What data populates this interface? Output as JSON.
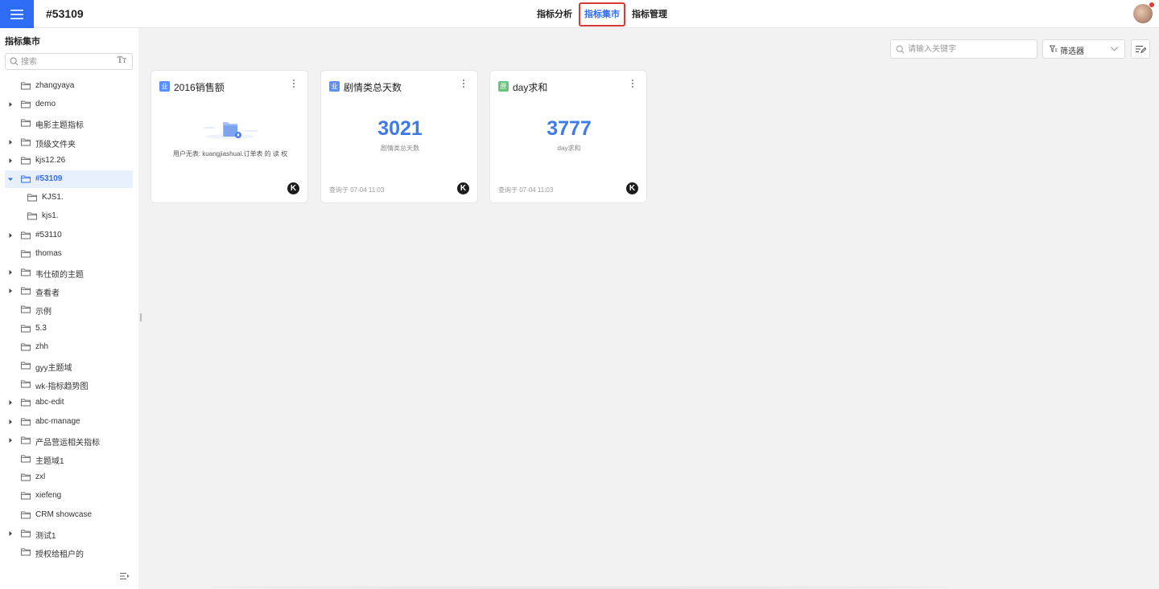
{
  "header": {
    "title": "#53109",
    "tabs": [
      {
        "label": "指标分析",
        "active": false
      },
      {
        "label": "指标集市",
        "active": true
      },
      {
        "label": "指标管理",
        "active": false
      }
    ],
    "accent_color": "#2f6cf6",
    "highlight_color": "#d73a35"
  },
  "sidebar": {
    "title": "指标集市",
    "search_placeholder": "搜索",
    "items": [
      {
        "label": "zhangyaya",
        "expandable": false,
        "expanded": false,
        "level": 0
      },
      {
        "label": "demo",
        "expandable": true,
        "expanded": false,
        "level": 0
      },
      {
        "label": "电影主题指标",
        "expandable": false,
        "expanded": false,
        "level": 0
      },
      {
        "label": "顶级文件夹",
        "expandable": true,
        "expanded": false,
        "level": 0
      },
      {
        "label": "kjs12.26",
        "expandable": true,
        "expanded": false,
        "level": 0
      },
      {
        "label": "#53109",
        "expandable": true,
        "expanded": true,
        "level": 0,
        "selected": true
      },
      {
        "label": "KJS1.",
        "expandable": false,
        "expanded": false,
        "level": 1
      },
      {
        "label": "kjs1.",
        "expandable": false,
        "expanded": false,
        "level": 1
      },
      {
        "label": "#53110",
        "expandable": true,
        "expanded": false,
        "level": 0
      },
      {
        "label": "thomas",
        "expandable": false,
        "expanded": false,
        "level": 0
      },
      {
        "label": "韦仕硕的主题",
        "expandable": true,
        "expanded": false,
        "level": 0
      },
      {
        "label": "查看者",
        "expandable": true,
        "expanded": false,
        "level": 0
      },
      {
        "label": "示例",
        "expandable": false,
        "expanded": false,
        "level": 0
      },
      {
        "label": "5.3",
        "expandable": false,
        "expanded": false,
        "level": 0
      },
      {
        "label": "zhh",
        "expandable": false,
        "expanded": false,
        "level": 0
      },
      {
        "label": "gyy主题域",
        "expandable": false,
        "expanded": false,
        "level": 0
      },
      {
        "label": "wk-指标趋势图",
        "expandable": false,
        "expanded": false,
        "level": 0
      },
      {
        "label": "abc-edit",
        "expandable": true,
        "expanded": false,
        "level": 0
      },
      {
        "label": "abc-manage",
        "expandable": true,
        "expanded": false,
        "level": 0
      },
      {
        "label": "产品营运相关指标",
        "expandable": true,
        "expanded": false,
        "level": 0
      },
      {
        "label": "主题域1",
        "expandable": false,
        "expanded": false,
        "level": 0
      },
      {
        "label": "zxl",
        "expandable": false,
        "expanded": false,
        "level": 0
      },
      {
        "label": "xiefeng",
        "expandable": false,
        "expanded": false,
        "level": 0
      },
      {
        "label": "CRM showcase",
        "expandable": false,
        "expanded": false,
        "level": 0
      },
      {
        "label": "测试1",
        "expandable": true,
        "expanded": false,
        "level": 0
      },
      {
        "label": "授权给租户的",
        "expandable": false,
        "expanded": false,
        "level": 0
      }
    ]
  },
  "toolbar": {
    "search_placeholder": "请输入关键字",
    "filter_label": "筛选器"
  },
  "cards": [
    {
      "badge": "业",
      "badge_color": "#5b8ff9",
      "title": "2016销售额",
      "state": "error",
      "error_text": "用户无表: kuangjiashuai.订单表 的 读 权",
      "logo": "K"
    },
    {
      "badge": "业",
      "badge_color": "#5b8ff9",
      "title": "剧情类总天数",
      "state": "value",
      "value": "3021",
      "subtitle": "剧情类总天数",
      "query_time": "查询于 07-04 11:03",
      "logo": "K"
    },
    {
      "badge": "原",
      "badge_color": "#67c47a",
      "title": "day求和",
      "state": "value",
      "value": "3777",
      "subtitle": "day求和",
      "query_time": "查询于 07-04 11:03",
      "logo": "K"
    }
  ]
}
